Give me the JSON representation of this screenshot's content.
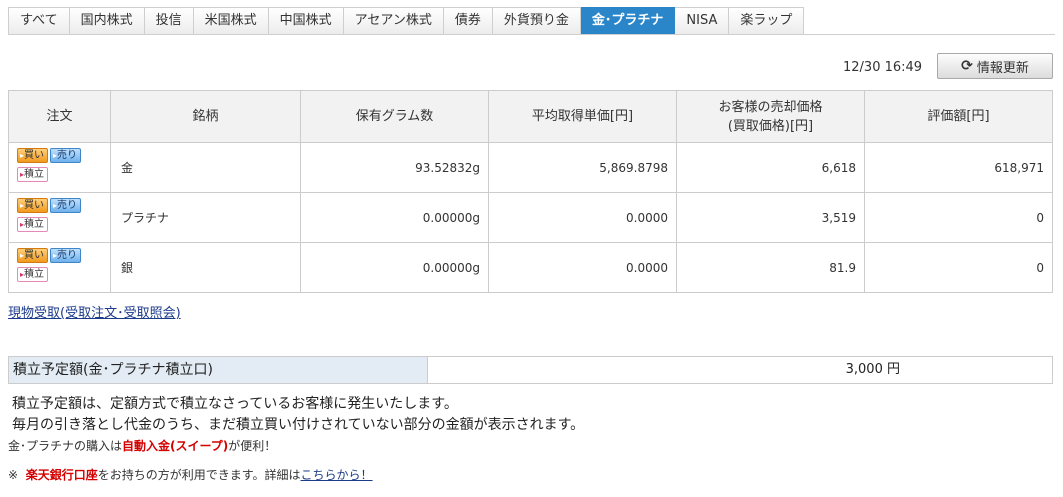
{
  "tabs": [
    "すべて",
    "国内株式",
    "投信",
    "米国株式",
    "中国株式",
    "アセアン株式",
    "債券",
    "外貨預り金",
    "金･プラチナ",
    "NISA",
    "楽ラップ"
  ],
  "active_tab": "金･プラチナ",
  "timestamp": "12/30 16:49",
  "refresh_label": "情報更新",
  "refresh_icon": "refresh-icon",
  "table": {
    "headers": {
      "order": "注文",
      "name": "銘柄",
      "grams": "保有グラム数",
      "avg_price": "平均取得単価[円]",
      "sell_price_l1": "お客様の売却価格",
      "sell_price_l2": "(買取価格)[円]",
      "value": "評価額[円]"
    },
    "buttons": {
      "buy": "買い",
      "sell": "売り",
      "tsumitate": "積立",
      "arrow": "▸"
    },
    "rows": [
      {
        "name": "金",
        "grams": "93.52832g",
        "avg_price": "5,869.8798",
        "sell_price": "6,618",
        "value": "618,971"
      },
      {
        "name": "プラチナ",
        "grams": "0.00000g",
        "avg_price": "0.0000",
        "sell_price": "3,519",
        "value": "0"
      },
      {
        "name": "銀",
        "grams": "0.00000g",
        "avg_price": "0.0000",
        "sell_price": "81.9",
        "value": "0"
      }
    ]
  },
  "receipt_link": "現物受取(受取注文･受取照会)",
  "schedule": {
    "label": "積立予定額(金･プラチナ積立口)",
    "amount": "3,000",
    "unit": "円"
  },
  "notes": {
    "line1": "積立予定額は、定額方式で積立なさっているお客様に発生いたします。",
    "line2": "毎月の引き落とし代金のうち、まだ積立買い付けされていない部分の金額が表示されます。",
    "line3_pre": "金･プラチナの購入は",
    "line3_emph": "自動入金(スイープ)",
    "line3_post": "が便利！",
    "line4_mark": "※",
    "line4_emph": "楽天銀行口座",
    "line4_mid": "をお持ちの方が利用できます。詳細は",
    "line4_link": "こちらから！"
  }
}
